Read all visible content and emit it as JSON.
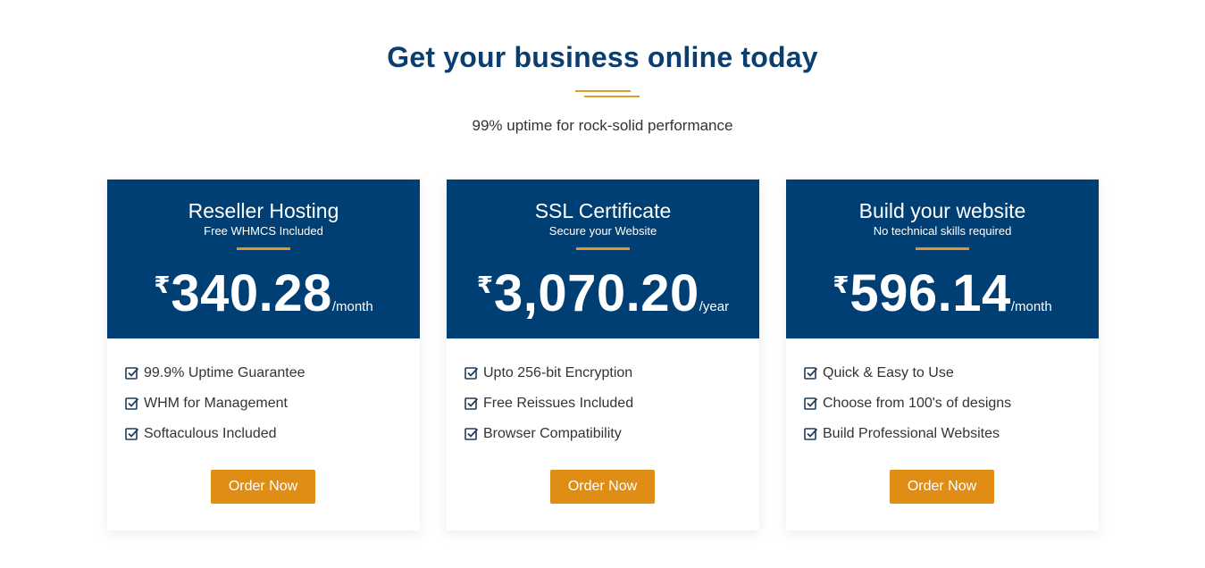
{
  "section": {
    "title": "Get your business online today",
    "subtitle": "99% uptime for rock-solid performance"
  },
  "cards": [
    {
      "title": "Reseller Hosting",
      "subtitle": "Free WHMCS Included",
      "currency": "₹",
      "price": "340.28",
      "period": "/month",
      "features": [
        "99.9% Uptime Guarantee",
        "WHM for Management",
        "Softaculous Included"
      ],
      "button": "Order Now"
    },
    {
      "title": "SSL Certificate",
      "subtitle": "Secure your Website",
      "currency": "₹",
      "price": "3,070.20",
      "period": "/year",
      "features": [
        "Upto 256-bit Encryption",
        "Free Reissues Included",
        "Browser Compatibility"
      ],
      "button": "Order Now"
    },
    {
      "title": "Build your website",
      "subtitle": "No technical skills required",
      "currency": "₹",
      "price": "596.14",
      "period": "/month",
      "features": [
        "Quick & Easy to Use",
        "Choose from 100's of designs",
        "Build Professional Websites"
      ],
      "button": "Order Now"
    }
  ],
  "colors": {
    "heading": "#0b3e6f",
    "card_header": "#003f73",
    "accent": "#e29a2a",
    "button": "#df8d14"
  },
  "icons": {
    "feature": "check-square-icon"
  }
}
